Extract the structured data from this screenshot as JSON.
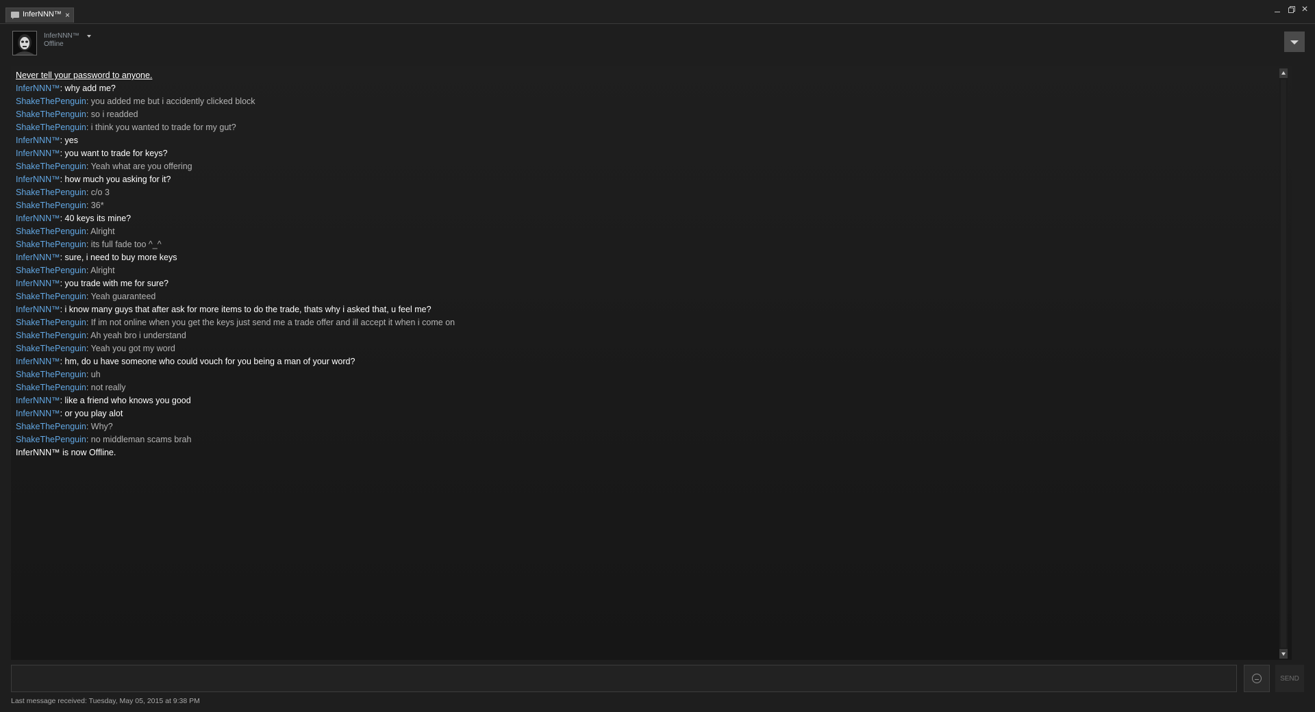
{
  "tab": {
    "label": "InferNNN™",
    "icon": "chat-bubble-icon",
    "close": "×"
  },
  "window_controls": {
    "minimize": "minimize-icon",
    "maximize": "restore-icon",
    "close": "×"
  },
  "header": {
    "name": "InferNNN™",
    "status": "Offline"
  },
  "colors": {
    "sender_name": "#62a7e3",
    "self_text": "#ffffff",
    "other_text": "#b4b4b4",
    "background": "#1e1e1e"
  },
  "messages": [
    {
      "type": "warning",
      "sender": "",
      "text": "Never tell your password to anyone."
    },
    {
      "type": "self",
      "sender": "InferNNN™",
      "text": ": why add me?"
    },
    {
      "type": "other",
      "sender": "ShakeThePenguin",
      "text": ": you added me but i accidently clicked block"
    },
    {
      "type": "other",
      "sender": "ShakeThePenguin",
      "text": ": so i readded"
    },
    {
      "type": "other",
      "sender": "ShakeThePenguin",
      "text": ": i think you wanted to trade for my gut?"
    },
    {
      "type": "self",
      "sender": "InferNNN™",
      "text": ": yes"
    },
    {
      "type": "self",
      "sender": "InferNNN™",
      "text": ": you want to trade for keys?"
    },
    {
      "type": "other",
      "sender": "ShakeThePenguin",
      "text": ": Yeah what are you offering"
    },
    {
      "type": "self",
      "sender": "InferNNN™",
      "text": ": how much you asking for it?"
    },
    {
      "type": "other",
      "sender": "ShakeThePenguin",
      "text": ": c/o 3"
    },
    {
      "type": "other",
      "sender": "ShakeThePenguin",
      "text": ": 36*"
    },
    {
      "type": "self",
      "sender": "InferNNN™",
      "text": ": 40 keys its mine?"
    },
    {
      "type": "other",
      "sender": "ShakeThePenguin",
      "text": ": Alright"
    },
    {
      "type": "other",
      "sender": "ShakeThePenguin",
      "text": ": its full fade too ^_^"
    },
    {
      "type": "self",
      "sender": "InferNNN™",
      "text": ": sure, i need to buy more keys"
    },
    {
      "type": "other",
      "sender": "ShakeThePenguin",
      "text": ": Alright"
    },
    {
      "type": "self",
      "sender": "InferNNN™",
      "text": ": you trade with me for sure?"
    },
    {
      "type": "other",
      "sender": "ShakeThePenguin",
      "text": ": Yeah guaranteed"
    },
    {
      "type": "self",
      "sender": "InferNNN™",
      "text": ": i know many guys that after ask for more items to do the trade, thats why i asked that, u feel me?"
    },
    {
      "type": "other",
      "sender": "ShakeThePenguin",
      "text": ": If im not online when you get the keys just send me a trade offer and ill accept it when i come on"
    },
    {
      "type": "other",
      "sender": "ShakeThePenguin",
      "text": ": Ah yeah bro i understand"
    },
    {
      "type": "other",
      "sender": "ShakeThePenguin",
      "text": ": Yeah you got my word"
    },
    {
      "type": "self",
      "sender": "InferNNN™",
      "text": ": hm, do u have someone who could vouch for you being a man of your word?"
    },
    {
      "type": "other",
      "sender": "ShakeThePenguin",
      "text": ": uh"
    },
    {
      "type": "other",
      "sender": "ShakeThePenguin",
      "text": ": not really"
    },
    {
      "type": "self",
      "sender": "InferNNN™",
      "text": ": like a friend who knows you good"
    },
    {
      "type": "self",
      "sender": "InferNNN™",
      "text": ": or you play alot"
    },
    {
      "type": "other",
      "sender": "ShakeThePenguin",
      "text": ": Why?"
    },
    {
      "type": "other",
      "sender": "ShakeThePenguin",
      "text": ": no middleman scams brah"
    },
    {
      "type": "system",
      "sender": "",
      "text": "InferNNN™ is now Offline."
    }
  ],
  "input": {
    "value": "",
    "placeholder": "",
    "emoji_icon": "emoticon-icon",
    "send_label": "SEND"
  },
  "footer": {
    "status": "Last message received: Tuesday, May 05, 2015 at 9:38 PM"
  }
}
